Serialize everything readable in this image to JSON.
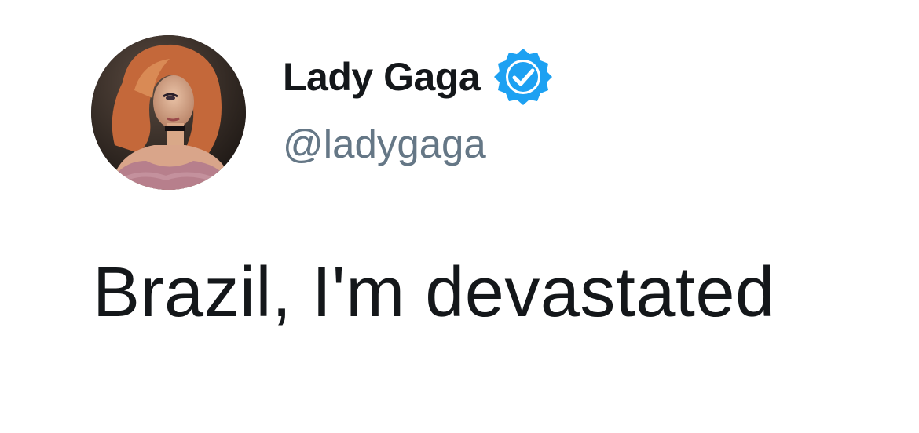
{
  "tweet": {
    "author": {
      "display_name": "Lady Gaga",
      "handle": "@ladygaga",
      "verified": true,
      "avatar_icon": "profile-photo"
    },
    "text": "Brazil, I'm devastated"
  },
  "colors": {
    "name_text": "#14171a",
    "handle_text": "#657786",
    "verified_badge": "#1da1f2",
    "background": "#ffffff"
  }
}
